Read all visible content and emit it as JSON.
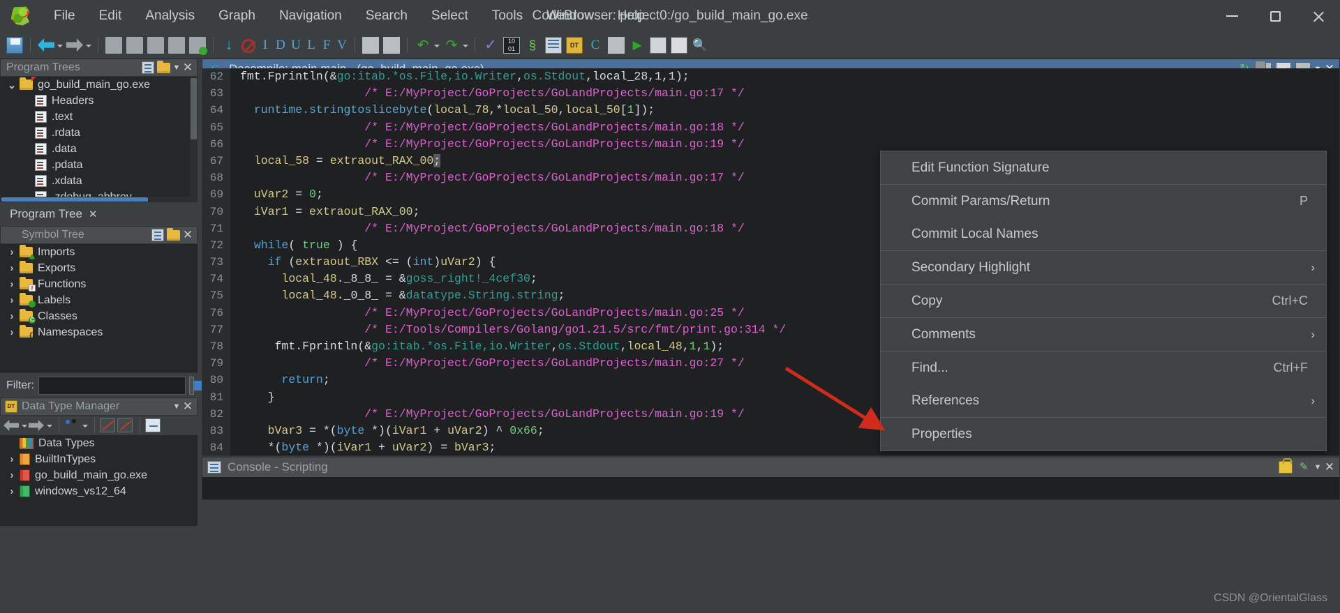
{
  "window": {
    "title": "CodeBrowser: project0:/go_build_main_go.exe",
    "minimize_label": "Minimize",
    "maximize_label": "Maximize",
    "close_label": "Close",
    "logo_name": "ghidra-dragon-logo"
  },
  "menubar": {
    "items": [
      {
        "label": "File"
      },
      {
        "label": "Edit"
      },
      {
        "label": "Analysis"
      },
      {
        "label": "Graph"
      },
      {
        "label": "Navigation"
      },
      {
        "label": "Search"
      },
      {
        "label": "Select"
      },
      {
        "label": "Tools"
      },
      {
        "label": "Window"
      },
      {
        "label": "Help"
      }
    ]
  },
  "toolbar": {
    "letters": [
      "I",
      "D",
      "U",
      "L",
      "F",
      "V"
    ]
  },
  "program_trees": {
    "title": "Program Trees",
    "tab_label": "Program Tree",
    "items": [
      {
        "label": "go_build_main_go.exe",
        "type": "folder-open",
        "depth": 0,
        "twisty": "⌄"
      },
      {
        "label": "Headers",
        "type": "fragment",
        "depth": 1
      },
      {
        "label": ".text",
        "type": "fragment",
        "depth": 1
      },
      {
        "label": ".rdata",
        "type": "fragment",
        "depth": 1
      },
      {
        "label": ".data",
        "type": "fragment",
        "depth": 1
      },
      {
        "label": ".pdata",
        "type": "fragment",
        "depth": 1
      },
      {
        "label": ".xdata",
        "type": "fragment",
        "depth": 1
      },
      {
        "label": ".zdebug_abbrev",
        "type": "fragment",
        "depth": 1
      }
    ]
  },
  "symbol_tree": {
    "title": "Symbol Tree",
    "filter_label": "Filter:",
    "filter_value": "",
    "filter_placeholder": "",
    "items": [
      {
        "label": "Imports",
        "badge": "tri"
      },
      {
        "label": "Exports",
        "badge": ""
      },
      {
        "label": "Functions",
        "badge": "f"
      },
      {
        "label": "Labels",
        "badge": "green"
      },
      {
        "label": "Classes",
        "badge": "c"
      },
      {
        "label": "Namespaces",
        "badge": "ns"
      }
    ]
  },
  "data_type_manager": {
    "title": "Data Type Manager",
    "items": [
      {
        "label": "Data Types",
        "type": "books",
        "twisty": ""
      },
      {
        "label": "BuiltInTypes",
        "type": "book-orange",
        "twisty": "›"
      },
      {
        "label": "go_build_main_go.exe",
        "type": "book-red",
        "twisty": "›"
      },
      {
        "label": "windows_vs12_64",
        "type": "book-green",
        "twisty": "›"
      }
    ]
  },
  "decompile": {
    "title": "Decompile: main.main -  (go_build_main_go.exe)",
    "lines": [
      {
        "n": "62",
        "partial": true,
        "tokens": [
          {
            "t": "fmt.Fprintln(&",
            "c": "t-pl"
          },
          {
            "t": "go:itab.*os.File,io.Writer",
            "c": "t-glob"
          },
          {
            "t": ",",
            "c": "t-pl"
          },
          {
            "t": "os.Stdout",
            "c": "t-glob"
          },
          {
            "t": ",local_28,1,1);",
            "c": "t-pl"
          }
        ]
      },
      {
        "n": "63",
        "tokens": [
          {
            "t": "                  ",
            "c": "t-pl"
          },
          {
            "t": "/* E:/MyProject/GoProjects/GoLandProjects/main.go:17 */",
            "c": "t-cm"
          }
        ]
      },
      {
        "n": "64",
        "tokens": [
          {
            "t": "  ",
            "c": "t-pl"
          },
          {
            "t": "runtime.stringtoslicebyte",
            "c": "t-fn"
          },
          {
            "t": "(",
            "c": "t-pl"
          },
          {
            "t": "local_78",
            "c": "t-var"
          },
          {
            "t": ",*",
            "c": "t-pl"
          },
          {
            "t": "local_50",
            "c": "t-var"
          },
          {
            "t": ",",
            "c": "t-pl"
          },
          {
            "t": "local_50",
            "c": "t-var"
          },
          {
            "t": "[",
            "c": "t-pl"
          },
          {
            "t": "1",
            "c": "t-num"
          },
          {
            "t": "]);",
            "c": "t-pl"
          }
        ]
      },
      {
        "n": "65",
        "tokens": [
          {
            "t": "                  ",
            "c": "t-pl"
          },
          {
            "t": "/* E:/MyProject/GoProjects/GoLandProjects/main.go:18 */",
            "c": "t-cm"
          }
        ]
      },
      {
        "n": "66",
        "tokens": [
          {
            "t": "                  ",
            "c": "t-pl"
          },
          {
            "t": "/* E:/MyProject/GoProjects/GoLandProjects/main.go:19 */",
            "c": "t-cm"
          }
        ]
      },
      {
        "n": "67",
        "tokens": [
          {
            "t": "  ",
            "c": "t-pl"
          },
          {
            "t": "local_58",
            "c": "t-var"
          },
          {
            "t": " = ",
            "c": "t-pl"
          },
          {
            "t": "extraout_RAX_00",
            "c": "t-var"
          },
          {
            "t": ";",
            "c": "t-pl cursor-hl"
          }
        ]
      },
      {
        "n": "68",
        "tokens": [
          {
            "t": "                  ",
            "c": "t-pl"
          },
          {
            "t": "/* E:/MyProject/GoProjects/GoLandProjects/main.go:17 */",
            "c": "t-cm"
          }
        ]
      },
      {
        "n": "69",
        "tokens": [
          {
            "t": "  ",
            "c": "t-pl"
          },
          {
            "t": "uVar2",
            "c": "t-var"
          },
          {
            "t": " = ",
            "c": "t-pl"
          },
          {
            "t": "0",
            "c": "t-num"
          },
          {
            "t": ";",
            "c": "t-pl"
          }
        ]
      },
      {
        "n": "70",
        "tokens": [
          {
            "t": "  ",
            "c": "t-pl"
          },
          {
            "t": "iVar1",
            "c": "t-var"
          },
          {
            "t": " = ",
            "c": "t-pl"
          },
          {
            "t": "extraout_RAX_00",
            "c": "t-var"
          },
          {
            "t": ";",
            "c": "t-pl"
          }
        ]
      },
      {
        "n": "71",
        "tokens": [
          {
            "t": "                  ",
            "c": "t-pl"
          },
          {
            "t": "/* E:/MyProject/GoProjects/GoLandProjects/main.go:18 */",
            "c": "t-cm"
          }
        ]
      },
      {
        "n": "72",
        "tokens": [
          {
            "t": "  ",
            "c": "t-pl"
          },
          {
            "t": "while",
            "c": "t-kw"
          },
          {
            "t": "( ",
            "c": "t-pl"
          },
          {
            "t": "true",
            "c": "t-true"
          },
          {
            "t": " ) {",
            "c": "t-pl"
          }
        ]
      },
      {
        "n": "73",
        "tokens": [
          {
            "t": "    ",
            "c": "t-pl"
          },
          {
            "t": "if",
            "c": "t-kw"
          },
          {
            "t": " (",
            "c": "t-pl"
          },
          {
            "t": "extraout_RBX",
            "c": "t-var"
          },
          {
            "t": " <= (",
            "c": "t-pl"
          },
          {
            "t": "int",
            "c": "t-kw"
          },
          {
            "t": ")",
            "c": "t-pl"
          },
          {
            "t": "uVar2",
            "c": "t-var"
          },
          {
            "t": ") {",
            "c": "t-pl"
          }
        ]
      },
      {
        "n": "74",
        "tokens": [
          {
            "t": "      ",
            "c": "t-pl"
          },
          {
            "t": "local_48",
            "c": "t-var"
          },
          {
            "t": "._8_8_ = &",
            "c": "t-pl"
          },
          {
            "t": "goss_right!_4cef30",
            "c": "t-glob"
          },
          {
            "t": ";",
            "c": "t-pl"
          }
        ]
      },
      {
        "n": "75",
        "tokens": [
          {
            "t": "      ",
            "c": "t-pl"
          },
          {
            "t": "local_48",
            "c": "t-var"
          },
          {
            "t": "._0_8_ = &",
            "c": "t-pl"
          },
          {
            "t": "datatype.String.string",
            "c": "t-glob"
          },
          {
            "t": ";",
            "c": "t-pl"
          }
        ]
      },
      {
        "n": "76",
        "tokens": [
          {
            "t": "                  ",
            "c": "t-pl"
          },
          {
            "t": "/* E:/MyProject/GoProjects/GoLandProjects/main.go:25 */",
            "c": "t-cm"
          }
        ]
      },
      {
        "n": "77",
        "tokens": [
          {
            "t": "                  ",
            "c": "t-pl"
          },
          {
            "t": "/* E:/Tools/Compilers/Golang/go1.21.5/src/fmt/print.go:314 */",
            "c": "t-cm"
          }
        ]
      },
      {
        "n": "78",
        "tokens": [
          {
            "t": "     ",
            "c": "t-pl"
          },
          {
            "t": "fmt.Fprintln",
            "c": "t-pl"
          },
          {
            "t": "(&",
            "c": "t-pl"
          },
          {
            "t": "go:itab.*os.File,io.Writer",
            "c": "t-glob"
          },
          {
            "t": ",",
            "c": "t-pl"
          },
          {
            "t": "os.Stdout",
            "c": "t-glob"
          },
          {
            "t": ",",
            "c": "t-pl"
          },
          {
            "t": "local_48",
            "c": "t-var"
          },
          {
            "t": ",",
            "c": "t-pl"
          },
          {
            "t": "1",
            "c": "t-num"
          },
          {
            "t": ",",
            "c": "t-pl"
          },
          {
            "t": "1",
            "c": "t-num"
          },
          {
            "t": ");",
            "c": "t-pl"
          }
        ]
      },
      {
        "n": "79",
        "tokens": [
          {
            "t": "                  ",
            "c": "t-pl"
          },
          {
            "t": "/* E:/MyProject/GoProjects/GoLandProjects/main.go:27 */",
            "c": "t-cm"
          }
        ]
      },
      {
        "n": "80",
        "tokens": [
          {
            "t": "      ",
            "c": "t-pl"
          },
          {
            "t": "return",
            "c": "t-kw"
          },
          {
            "t": ";",
            "c": "t-pl"
          }
        ]
      },
      {
        "n": "81",
        "tokens": [
          {
            "t": "    }",
            "c": "t-pl"
          }
        ]
      },
      {
        "n": "82",
        "tokens": [
          {
            "t": "                  ",
            "c": "t-pl"
          },
          {
            "t": "/* E:/MyProject/GoProjects/GoLandProjects/main.go:19 */",
            "c": "t-cm"
          }
        ]
      },
      {
        "n": "83",
        "tokens": [
          {
            "t": "    ",
            "c": "t-pl"
          },
          {
            "t": "bVar3",
            "c": "t-var"
          },
          {
            "t": " = *(",
            "c": "t-pl"
          },
          {
            "t": "byte",
            "c": "t-kw"
          },
          {
            "t": " *)(",
            "c": "t-pl"
          },
          {
            "t": "iVar1",
            "c": "t-var"
          },
          {
            "t": " + ",
            "c": "t-pl"
          },
          {
            "t": "uVar2",
            "c": "t-var"
          },
          {
            "t": ") ^ ",
            "c": "t-pl"
          },
          {
            "t": "0x66",
            "c": "t-num"
          },
          {
            "t": ";",
            "c": "t-pl"
          }
        ]
      },
      {
        "n": "84",
        "partial": true,
        "tokens": [
          {
            "t": "    *(",
            "c": "t-pl"
          },
          {
            "t": "byte",
            "c": "t-kw"
          },
          {
            "t": " *)(",
            "c": "t-pl"
          },
          {
            "t": "iVar1",
            "c": "t-var"
          },
          {
            "t": " + ",
            "c": "t-pl"
          },
          {
            "t": "uVar2",
            "c": "t-var"
          },
          {
            "t": ") = ",
            "c": "t-pl"
          },
          {
            "t": "bVar3",
            "c": "t-var"
          },
          {
            "t": ";",
            "c": "t-pl"
          }
        ]
      }
    ]
  },
  "context_menu": {
    "items": [
      {
        "label": "Edit Function Signature",
        "accel": "",
        "submenu": false,
        "sep_after": true
      },
      {
        "label": "Commit Params/Return",
        "accel": "P",
        "submenu": false,
        "sep_after": false
      },
      {
        "label": "Commit Local Names",
        "accel": "",
        "submenu": false,
        "sep_after": true
      },
      {
        "label": "Secondary Highlight",
        "accel": "",
        "submenu": true,
        "sep_after": true
      },
      {
        "label": "Copy",
        "accel": "Ctrl+C",
        "submenu": false,
        "sep_after": true
      },
      {
        "label": "Comments",
        "accel": "",
        "submenu": true,
        "sep_after": true
      },
      {
        "label": "Find...",
        "accel": "Ctrl+F",
        "submenu": false,
        "sep_after": false
      },
      {
        "label": "References",
        "accel": "",
        "submenu": true,
        "sep_after": true
      },
      {
        "label": "Properties",
        "accel": "",
        "submenu": false,
        "sep_after": false
      }
    ]
  },
  "console": {
    "title": "Console - Scripting"
  },
  "watermark": {
    "text": "CSDN @OrientalGlass"
  },
  "colors": {
    "accent_blue": "#4a6f9a",
    "panel_bg": "#3c3f41",
    "code_bg": "#1e2022",
    "comment": "#e05fd0",
    "keyword": "#4fa3d9",
    "annotation_red": "#d12b1e"
  }
}
